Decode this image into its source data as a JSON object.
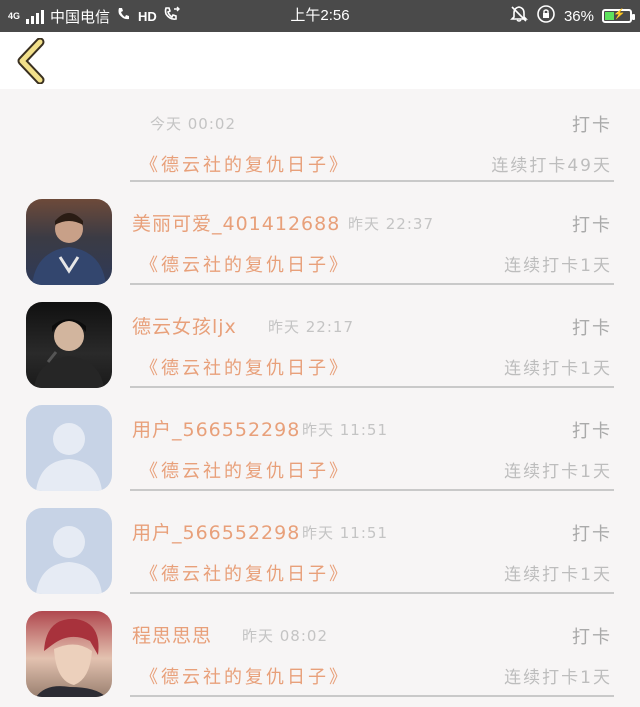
{
  "status_bar": {
    "network": "4G",
    "carrier": "中国电信",
    "hd": "HD",
    "time": "上午2:56",
    "battery": "36%",
    "battery_level": 0.36,
    "icons": [
      "signal-icon",
      "wifi-call-icon",
      "mute-icon",
      "orientation-lock-icon",
      "battery-icon"
    ]
  },
  "nav": {
    "back_icon": "chevron-left-icon"
  },
  "colors": {
    "accent": "#e8a07a",
    "muted": "#aaaaaa",
    "back": "#f2e08a"
  },
  "feed": [
    {
      "username": "",
      "time": "今天 00:02",
      "action": "打卡",
      "book": "《德云社的复仇日子》",
      "streak": "连续打卡49天",
      "avatar": "none"
    },
    {
      "username": "美丽可爱_401412688",
      "time": "昨天 22:37",
      "action": "打卡",
      "book": "《德云社的复仇日子》",
      "streak": "连续打卡1天",
      "avatar": "photo"
    },
    {
      "username": "德云女孩ljx",
      "time": "昨天 22:17",
      "action": "打卡",
      "book": "《德云社的复仇日子》",
      "streak": "连续打卡1天",
      "avatar": "photo"
    },
    {
      "username": "用户_566552298",
      "time": "昨天 11:51",
      "action": "打卡",
      "book": "《德云社的复仇日子》",
      "streak": "连续打卡1天",
      "avatar": "default"
    },
    {
      "username": "用户_566552298",
      "time": "昨天 11:51",
      "action": "打卡",
      "book": "《德云社的复仇日子》",
      "streak": "连续打卡1天",
      "avatar": "default"
    },
    {
      "username": "程思思思",
      "time": "昨天 08:02",
      "action": "打卡",
      "book": "《德云社的复仇日子》",
      "streak": "连续打卡1天",
      "avatar": "photo"
    }
  ]
}
